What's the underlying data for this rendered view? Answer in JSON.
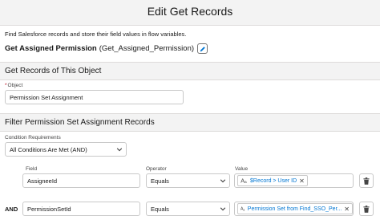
{
  "header": {
    "title": "Edit Get Records"
  },
  "description": "Find Salesforce records and store their field values in flow variables.",
  "element": {
    "label": "Get Assigned Permission",
    "api_name": "(Get_Assigned_Permission)"
  },
  "section_object": {
    "title": "Get Records of This Object",
    "object_label": "Object",
    "object_value": "Permission Set Assignment"
  },
  "section_filter": {
    "title": "Filter Permission Set Assignment Records",
    "condition_label": "Condition Requirements",
    "condition_value": "All Conditions Are Met (AND)",
    "column_field": "Field",
    "column_operator": "Operator",
    "column_value": "Value",
    "rows": [
      {
        "connector": "",
        "field": "AssigneeId",
        "operator": "Equals",
        "value": "$Record > User ID"
      },
      {
        "connector": "AND",
        "field": "PermissionSetId",
        "operator": "Equals",
        "value": "Permission Set from Find_SSO_Per..."
      }
    ]
  },
  "icons": {
    "edit": "pencil-icon",
    "dropdown": "chevron-down-icon",
    "resource": "text-resource-icon",
    "remove": "close-icon",
    "delete": "trash-icon"
  },
  "colors": {
    "header_bg": "#f3f3f3",
    "link": "#0176d3",
    "border": "#c9c9c9",
    "required": "#ba0517"
  }
}
